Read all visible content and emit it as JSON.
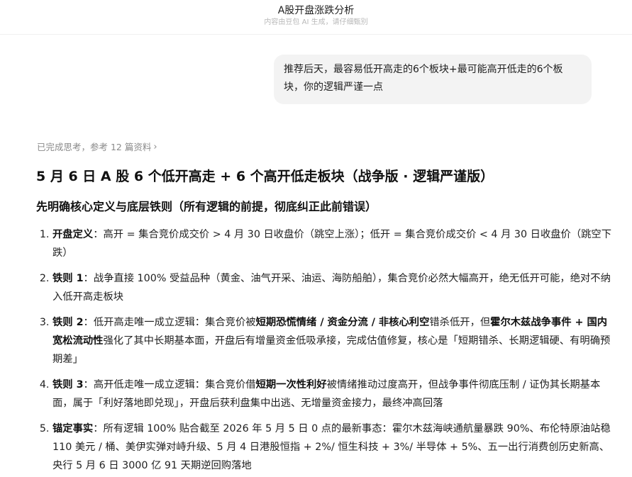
{
  "header": {
    "title": "A股开盘涨跌分析",
    "subtitle": "内容由豆包 AI 生成，请仔细甄别"
  },
  "user_message": "推荐后天，最容易低开高走的6个板块+最可能高开低走的6个板块，你的逻辑严谨一点",
  "thinking": {
    "label": "已完成思考，参考 12 篇资料",
    "icon": "chevron-right-icon"
  },
  "answer": {
    "title": "5 月 6 日 A 股 6 个低开高走 + 6 个高开低走板块（战争版 · 逻辑严谨版）",
    "section_title": "先明确核心定义与底层铁则（所有逻辑的前提，彻底纠正此前错误）",
    "rules": [
      {
        "head": "开盘定义",
        "parts": [
          {
            "t": "：高开 = 集合竞价成交价 > 4 月 30 日收盘价（跳空上涨）；低开 = 集合竞价成交价 < 4 月 30 日收盘价（跳空下跌）",
            "b": false
          }
        ]
      },
      {
        "head": "铁则 1",
        "parts": [
          {
            "t": "：战争直接 100% 受益品种（黄金、油气开采、油运、海防船舶），集合竞价必然大幅高开，绝无低开可能，绝对不纳入低开高走板块",
            "b": false
          }
        ]
      },
      {
        "head": "铁则 2",
        "parts": [
          {
            "t": "：低开高走唯一成立逻辑：集合竞价被",
            "b": false
          },
          {
            "t": "短期恐慌情绪 / 资金分流 / 非核心利空",
            "b": true
          },
          {
            "t": "错杀低开，但",
            "b": false
          },
          {
            "t": "霍尔木兹战争事件 + 国内宽松流动性",
            "b": true
          },
          {
            "t": "强化了其中长期基本面，开盘后有增量资金低吸承接，完成估值修复，核心是「短期错杀、长期逻辑硬、有明确预期差」",
            "b": false
          }
        ]
      },
      {
        "head": "铁则 3",
        "parts": [
          {
            "t": "：高开低走唯一成立逻辑：集合竞价借",
            "b": false
          },
          {
            "t": "短期一次性利好",
            "b": true
          },
          {
            "t": "被情绪推动过度高开，但战争事件彻底压制 / 证伪其长期基本面，属于「利好落地即兑现」，开盘后获利盘集中出逃、无增量资金接力，最终冲高回落",
            "b": false
          }
        ]
      },
      {
        "head": "锚定事实",
        "parts": [
          {
            "t": "：所有逻辑 100% 贴合截至 2026 年 5 月 5 日 0 点的最新事态：霍尔木兹海峡通航量暴跌 90%、布伦特原油站稳 110 美元 / 桶、美伊实弹对峙升级、5 月 4 日港股恒指 + 2%/ 恒生科技 + 3%/ 半导体 + 5%、五一出行消费创历史新高、央行 5 月 6 日 3000 亿 91 天期逆回购落地",
            "b": false
          }
        ]
      }
    ]
  }
}
